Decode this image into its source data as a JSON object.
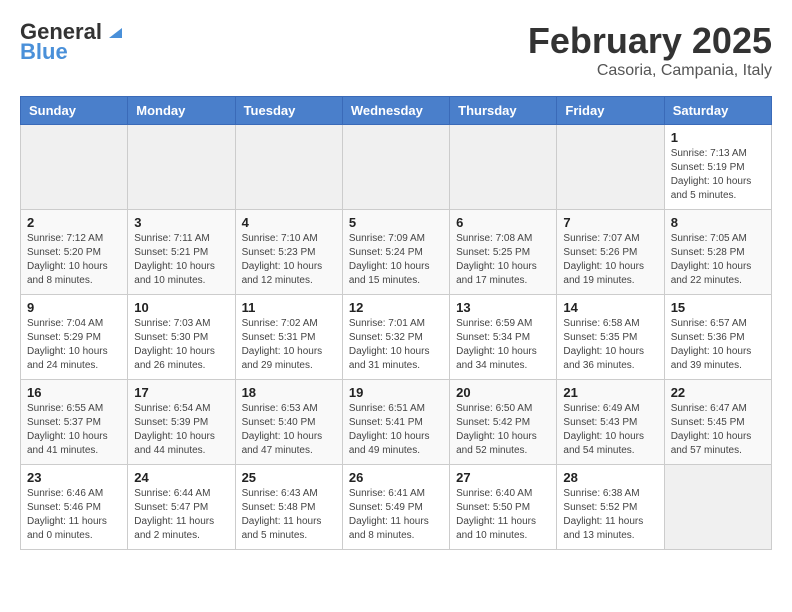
{
  "logo": {
    "line1": "General",
    "line2": "Blue"
  },
  "header": {
    "month": "February 2025",
    "location": "Casoria, Campania, Italy"
  },
  "weekdays": [
    "Sunday",
    "Monday",
    "Tuesday",
    "Wednesday",
    "Thursday",
    "Friday",
    "Saturday"
  ],
  "weeks": [
    [
      {
        "day": "",
        "info": ""
      },
      {
        "day": "",
        "info": ""
      },
      {
        "day": "",
        "info": ""
      },
      {
        "day": "",
        "info": ""
      },
      {
        "day": "",
        "info": ""
      },
      {
        "day": "",
        "info": ""
      },
      {
        "day": "1",
        "info": "Sunrise: 7:13 AM\nSunset: 5:19 PM\nDaylight: 10 hours\nand 5 minutes."
      }
    ],
    [
      {
        "day": "2",
        "info": "Sunrise: 7:12 AM\nSunset: 5:20 PM\nDaylight: 10 hours\nand 8 minutes."
      },
      {
        "day": "3",
        "info": "Sunrise: 7:11 AM\nSunset: 5:21 PM\nDaylight: 10 hours\nand 10 minutes."
      },
      {
        "day": "4",
        "info": "Sunrise: 7:10 AM\nSunset: 5:23 PM\nDaylight: 10 hours\nand 12 minutes."
      },
      {
        "day": "5",
        "info": "Sunrise: 7:09 AM\nSunset: 5:24 PM\nDaylight: 10 hours\nand 15 minutes."
      },
      {
        "day": "6",
        "info": "Sunrise: 7:08 AM\nSunset: 5:25 PM\nDaylight: 10 hours\nand 17 minutes."
      },
      {
        "day": "7",
        "info": "Sunrise: 7:07 AM\nSunset: 5:26 PM\nDaylight: 10 hours\nand 19 minutes."
      },
      {
        "day": "8",
        "info": "Sunrise: 7:05 AM\nSunset: 5:28 PM\nDaylight: 10 hours\nand 22 minutes."
      }
    ],
    [
      {
        "day": "9",
        "info": "Sunrise: 7:04 AM\nSunset: 5:29 PM\nDaylight: 10 hours\nand 24 minutes."
      },
      {
        "day": "10",
        "info": "Sunrise: 7:03 AM\nSunset: 5:30 PM\nDaylight: 10 hours\nand 26 minutes."
      },
      {
        "day": "11",
        "info": "Sunrise: 7:02 AM\nSunset: 5:31 PM\nDaylight: 10 hours\nand 29 minutes."
      },
      {
        "day": "12",
        "info": "Sunrise: 7:01 AM\nSunset: 5:32 PM\nDaylight: 10 hours\nand 31 minutes."
      },
      {
        "day": "13",
        "info": "Sunrise: 6:59 AM\nSunset: 5:34 PM\nDaylight: 10 hours\nand 34 minutes."
      },
      {
        "day": "14",
        "info": "Sunrise: 6:58 AM\nSunset: 5:35 PM\nDaylight: 10 hours\nand 36 minutes."
      },
      {
        "day": "15",
        "info": "Sunrise: 6:57 AM\nSunset: 5:36 PM\nDaylight: 10 hours\nand 39 minutes."
      }
    ],
    [
      {
        "day": "16",
        "info": "Sunrise: 6:55 AM\nSunset: 5:37 PM\nDaylight: 10 hours\nand 41 minutes."
      },
      {
        "day": "17",
        "info": "Sunrise: 6:54 AM\nSunset: 5:39 PM\nDaylight: 10 hours\nand 44 minutes."
      },
      {
        "day": "18",
        "info": "Sunrise: 6:53 AM\nSunset: 5:40 PM\nDaylight: 10 hours\nand 47 minutes."
      },
      {
        "day": "19",
        "info": "Sunrise: 6:51 AM\nSunset: 5:41 PM\nDaylight: 10 hours\nand 49 minutes."
      },
      {
        "day": "20",
        "info": "Sunrise: 6:50 AM\nSunset: 5:42 PM\nDaylight: 10 hours\nand 52 minutes."
      },
      {
        "day": "21",
        "info": "Sunrise: 6:49 AM\nSunset: 5:43 PM\nDaylight: 10 hours\nand 54 minutes."
      },
      {
        "day": "22",
        "info": "Sunrise: 6:47 AM\nSunset: 5:45 PM\nDaylight: 10 hours\nand 57 minutes."
      }
    ],
    [
      {
        "day": "23",
        "info": "Sunrise: 6:46 AM\nSunset: 5:46 PM\nDaylight: 11 hours\nand 0 minutes."
      },
      {
        "day": "24",
        "info": "Sunrise: 6:44 AM\nSunset: 5:47 PM\nDaylight: 11 hours\nand 2 minutes."
      },
      {
        "day": "25",
        "info": "Sunrise: 6:43 AM\nSunset: 5:48 PM\nDaylight: 11 hours\nand 5 minutes."
      },
      {
        "day": "26",
        "info": "Sunrise: 6:41 AM\nSunset: 5:49 PM\nDaylight: 11 hours\nand 8 minutes."
      },
      {
        "day": "27",
        "info": "Sunrise: 6:40 AM\nSunset: 5:50 PM\nDaylight: 11 hours\nand 10 minutes."
      },
      {
        "day": "28",
        "info": "Sunrise: 6:38 AM\nSunset: 5:52 PM\nDaylight: 11 hours\nand 13 minutes."
      },
      {
        "day": "",
        "info": ""
      }
    ]
  ]
}
